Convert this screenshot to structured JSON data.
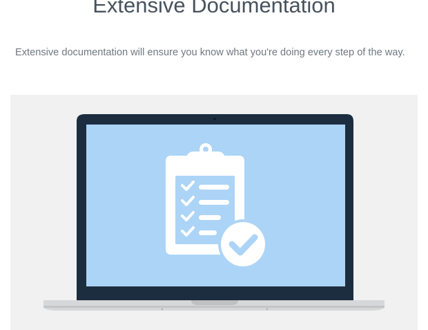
{
  "header": {
    "title": "Extensive Documentation",
    "subtitle": "Extensive documentation will ensure you know what you're doing every step of the way."
  },
  "illustration": {
    "subject": "laptop-with-clipboard-checklist",
    "colors": {
      "panel_background": "#f1f1f1",
      "laptop_bezel": "#1b2d3e",
      "screen": "#acd4f6",
      "icon": "#ffffff",
      "laptop_base": "#d6d7d9"
    }
  }
}
